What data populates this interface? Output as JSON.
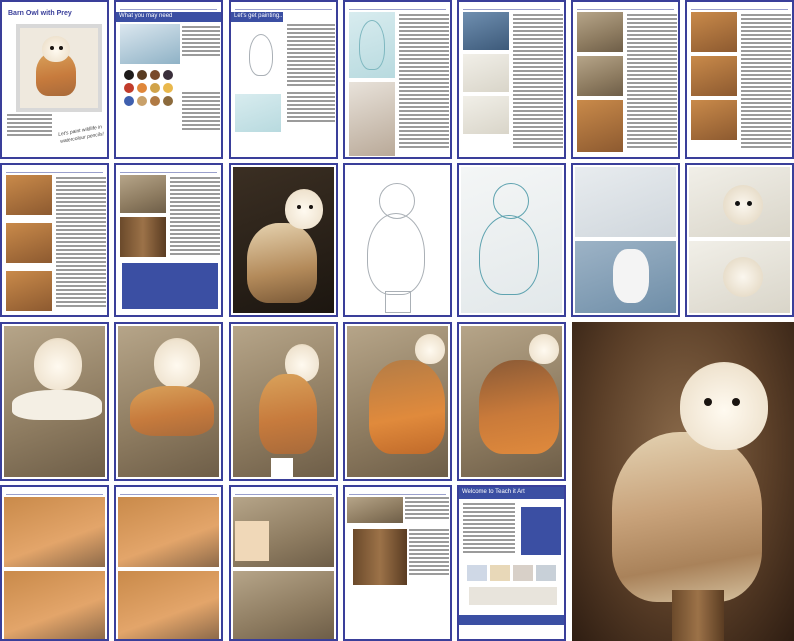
{
  "cover": {
    "title": "Barn Owl with Prey",
    "note_line1": "Let's paint wildlife in",
    "note_line2": "watercolour pencils!"
  },
  "page2": {
    "heading": "What you may need",
    "swatch_colors": [
      "#1e1b1a",
      "#5a3c22",
      "#7a4a2a",
      "#3a2f3b",
      "#c13c2b",
      "#e0873a",
      "#d1a34a",
      "#e9b84c",
      "#3f5fae",
      "#c9a16a",
      "#b07a44",
      "#8c6a3c"
    ]
  },
  "page3": {
    "heading": "Let's get painting..."
  },
  "page23": {
    "heading": "Welcome to Teach it Art"
  },
  "colors": {
    "frame": "#3a3f9a",
    "accent": "#3b4fa3"
  }
}
